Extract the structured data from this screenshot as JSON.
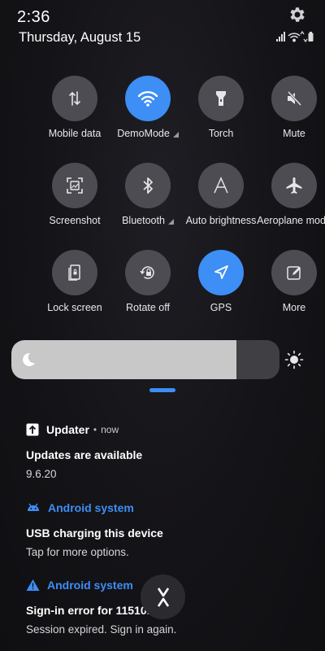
{
  "status": {
    "time": "2:36",
    "date": "Thursday, August 15"
  },
  "tiles": [
    {
      "label": "Mobile data",
      "on": false
    },
    {
      "label": "DemoMode",
      "on": true
    },
    {
      "label": "Torch",
      "on": false
    },
    {
      "label": "Mute",
      "on": false
    },
    {
      "label": "Screenshot",
      "on": false
    },
    {
      "label": "Bluetooth",
      "on": false
    },
    {
      "label": "Auto brightness",
      "on": false
    },
    {
      "label": "Aeroplane mode",
      "on": false
    },
    {
      "label": "Lock screen",
      "on": false
    },
    {
      "label": "Rotate off",
      "on": false
    },
    {
      "label": "GPS",
      "on": true
    },
    {
      "label": "More",
      "on": false
    }
  ],
  "brightness": {
    "level": 0.84
  },
  "notifications": [
    {
      "app": "Updater",
      "time": "now",
      "title": "Updates are available",
      "text": "9.6.20"
    },
    {
      "app": "Android system",
      "title": "USB charging this device",
      "text": "Tap for more options."
    },
    {
      "app": "Android system",
      "title": "Sign-in error for 11510.",
      "text": "Session expired. Sign in again."
    }
  ],
  "colors": {
    "accent": "#3d8ef5",
    "tile_off": "#4c4c52"
  }
}
